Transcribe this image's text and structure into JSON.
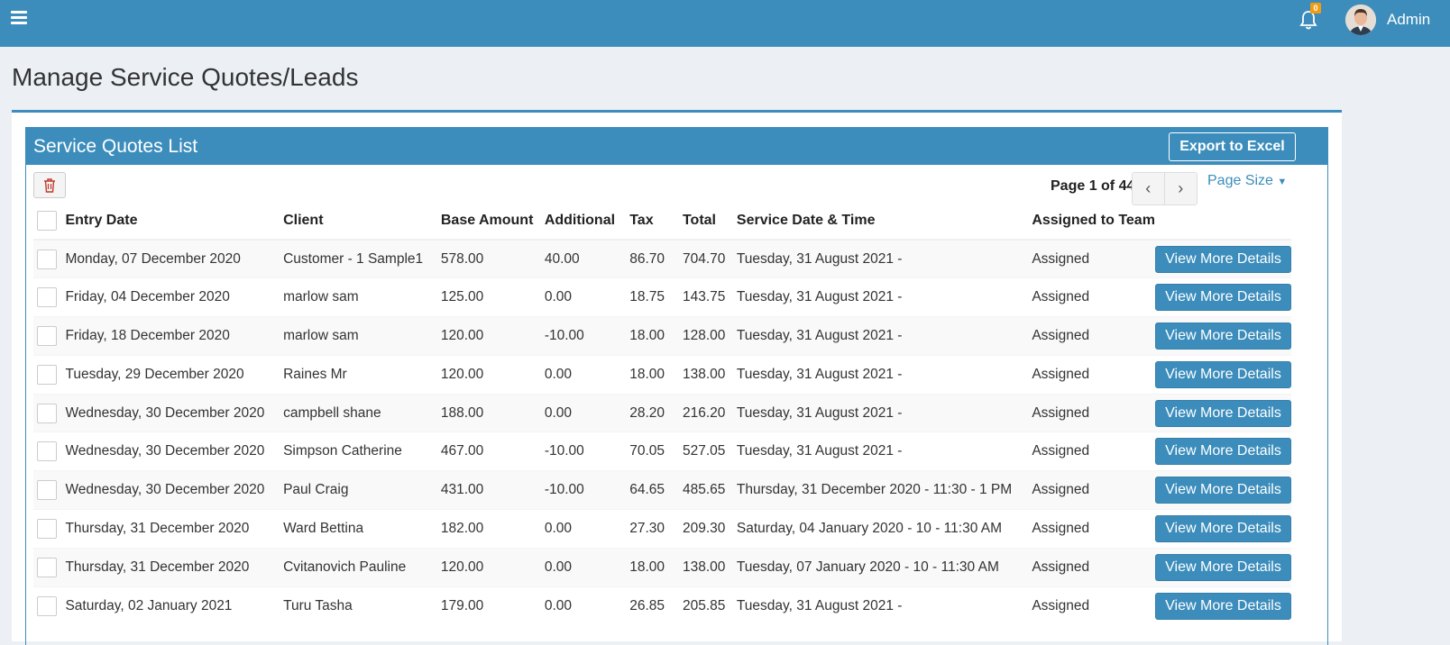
{
  "header": {
    "notification_count": "0",
    "user_name": "Admin",
    "brand_color": "#3c8dbc"
  },
  "page": {
    "title": "Manage Service Quotes/Leads"
  },
  "panel": {
    "title": "Service Quotes List",
    "export_label": "Export to Excel",
    "page_info": "Page 1 of 44",
    "page_size_label": "Page Size"
  },
  "table": {
    "columns": [
      "Entry Date",
      "Client",
      "Base Amount",
      "Additional",
      "Tax",
      "Total",
      "Service Date & Time",
      "Assigned to Team"
    ],
    "action_label": "View More Details",
    "rows": [
      {
        "entry_date": "Monday, 07 December 2020",
        "client": "Customer - 1 Sample1",
        "base": "578.00",
        "additional": "40.00",
        "tax": "86.70",
        "total": "704.70",
        "service": "Tuesday, 31 August 2021 -",
        "assigned": "Assigned"
      },
      {
        "entry_date": "Friday, 04 December 2020",
        "client": "marlow sam",
        "base": "125.00",
        "additional": "0.00",
        "tax": "18.75",
        "total": "143.75",
        "service": "Tuesday, 31 August 2021 -",
        "assigned": "Assigned"
      },
      {
        "entry_date": "Friday, 18 December 2020",
        "client": "marlow sam",
        "base": "120.00",
        "additional": "-10.00",
        "tax": "18.00",
        "total": "128.00",
        "service": "Tuesday, 31 August 2021 -",
        "assigned": "Assigned"
      },
      {
        "entry_date": "Tuesday, 29 December 2020",
        "client": "Raines Mr",
        "base": "120.00",
        "additional": "0.00",
        "tax": "18.00",
        "total": "138.00",
        "service": "Tuesday, 31 August 2021 -",
        "assigned": "Assigned"
      },
      {
        "entry_date": "Wednesday, 30 December 2020",
        "client": "campbell shane",
        "base": "188.00",
        "additional": "0.00",
        "tax": "28.20",
        "total": "216.20",
        "service": "Tuesday, 31 August 2021 -",
        "assigned": "Assigned"
      },
      {
        "entry_date": "Wednesday, 30 December 2020",
        "client": "Simpson Catherine",
        "base": "467.00",
        "additional": "-10.00",
        "tax": "70.05",
        "total": "527.05",
        "service": "Tuesday, 31 August 2021 -",
        "assigned": "Assigned"
      },
      {
        "entry_date": "Wednesday, 30 December 2020",
        "client": "Paul Craig",
        "base": "431.00",
        "additional": "-10.00",
        "tax": "64.65",
        "total": "485.65",
        "service": "Thursday, 31 December 2020 - 11:30 - 1 PM",
        "assigned": "Assigned"
      },
      {
        "entry_date": "Thursday, 31 December 2020",
        "client": "Ward Bettina",
        "base": "182.00",
        "additional": "0.00",
        "tax": "27.30",
        "total": "209.30",
        "service": "Saturday, 04 January 2020 - 10 - 11:30 AM",
        "assigned": "Assigned"
      },
      {
        "entry_date": "Thursday, 31 December 2020",
        "client": "Cvitanovich Pauline",
        "base": "120.00",
        "additional": "0.00",
        "tax": "18.00",
        "total": "138.00",
        "service": "Tuesday, 07 January 2020 - 10 - 11:30 AM",
        "assigned": "Assigned"
      },
      {
        "entry_date": "Saturday, 02 January 2021",
        "client": "Turu Tasha",
        "base": "179.00",
        "additional": "0.00",
        "tax": "26.85",
        "total": "205.85",
        "service": "Tuesday, 31 August 2021 -",
        "assigned": "Assigned"
      }
    ]
  }
}
